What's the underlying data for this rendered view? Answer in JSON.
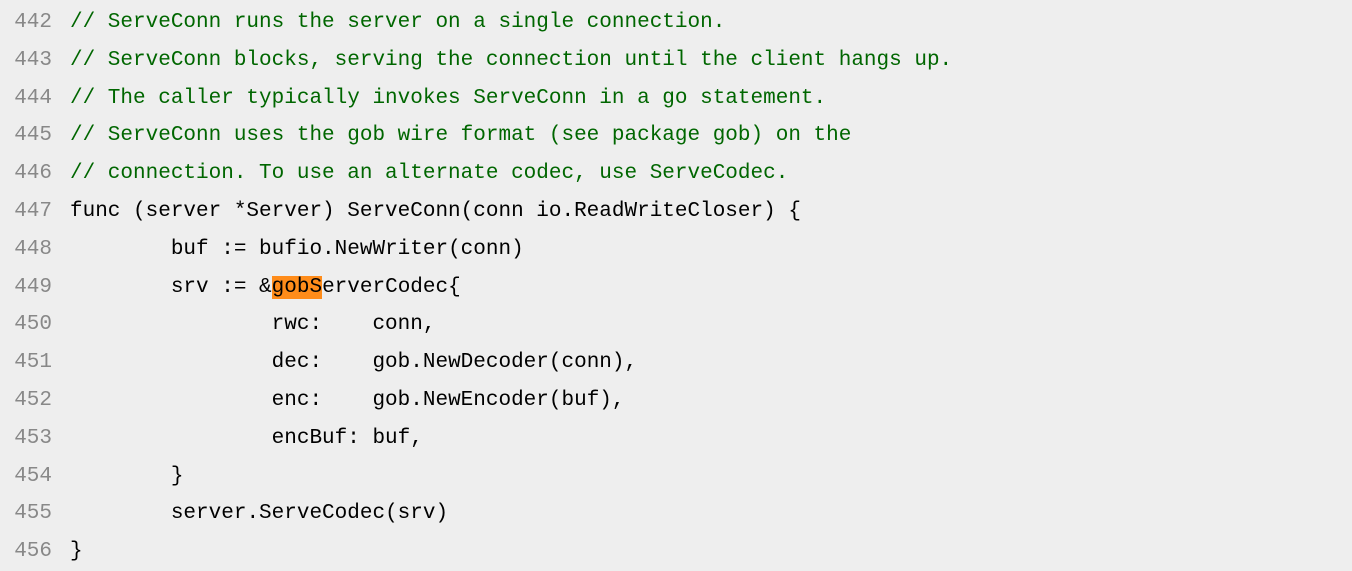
{
  "editor": {
    "startLine": 442,
    "highlight": "gobS",
    "lines": [
      {
        "num": "442",
        "type": "comment",
        "indent": "",
        "text": "// ServeConn runs the server on a single connection."
      },
      {
        "num": "443",
        "type": "comment",
        "indent": "",
        "text": "// ServeConn blocks, serving the connection until the client hangs up."
      },
      {
        "num": "444",
        "type": "comment",
        "indent": "",
        "text": "// The caller typically invokes ServeConn in a go statement."
      },
      {
        "num": "445",
        "type": "comment",
        "indent": "",
        "text": "// ServeConn uses the gob wire format (see package gob) on the"
      },
      {
        "num": "446",
        "type": "comment",
        "indent": "",
        "text": "// connection. To use an alternate codec, use ServeCodec."
      },
      {
        "num": "447",
        "type": "code",
        "indent": "",
        "text": "func (server *Server) ServeConn(conn io.ReadWriteCloser) {"
      },
      {
        "num": "448",
        "type": "code",
        "indent": "        ",
        "text": "buf := bufio.NewWriter(conn)"
      },
      {
        "num": "449",
        "type": "highlighted",
        "indent": "        ",
        "prefix": "srv := &",
        "hl": "gobS",
        "suffix": "erverCodec{"
      },
      {
        "num": "450",
        "type": "code",
        "indent": "                ",
        "text": "rwc:    conn,"
      },
      {
        "num": "451",
        "type": "code",
        "indent": "                ",
        "text": "dec:    gob.NewDecoder(conn),"
      },
      {
        "num": "452",
        "type": "code",
        "indent": "                ",
        "text": "enc:    gob.NewEncoder(buf),"
      },
      {
        "num": "453",
        "type": "code",
        "indent": "                ",
        "text": "encBuf: buf,"
      },
      {
        "num": "454",
        "type": "code",
        "indent": "        ",
        "text": "}"
      },
      {
        "num": "455",
        "type": "code",
        "indent": "        ",
        "text": "server.ServeCodec(srv)"
      },
      {
        "num": "456",
        "type": "code",
        "indent": "",
        "text": "}"
      }
    ]
  }
}
